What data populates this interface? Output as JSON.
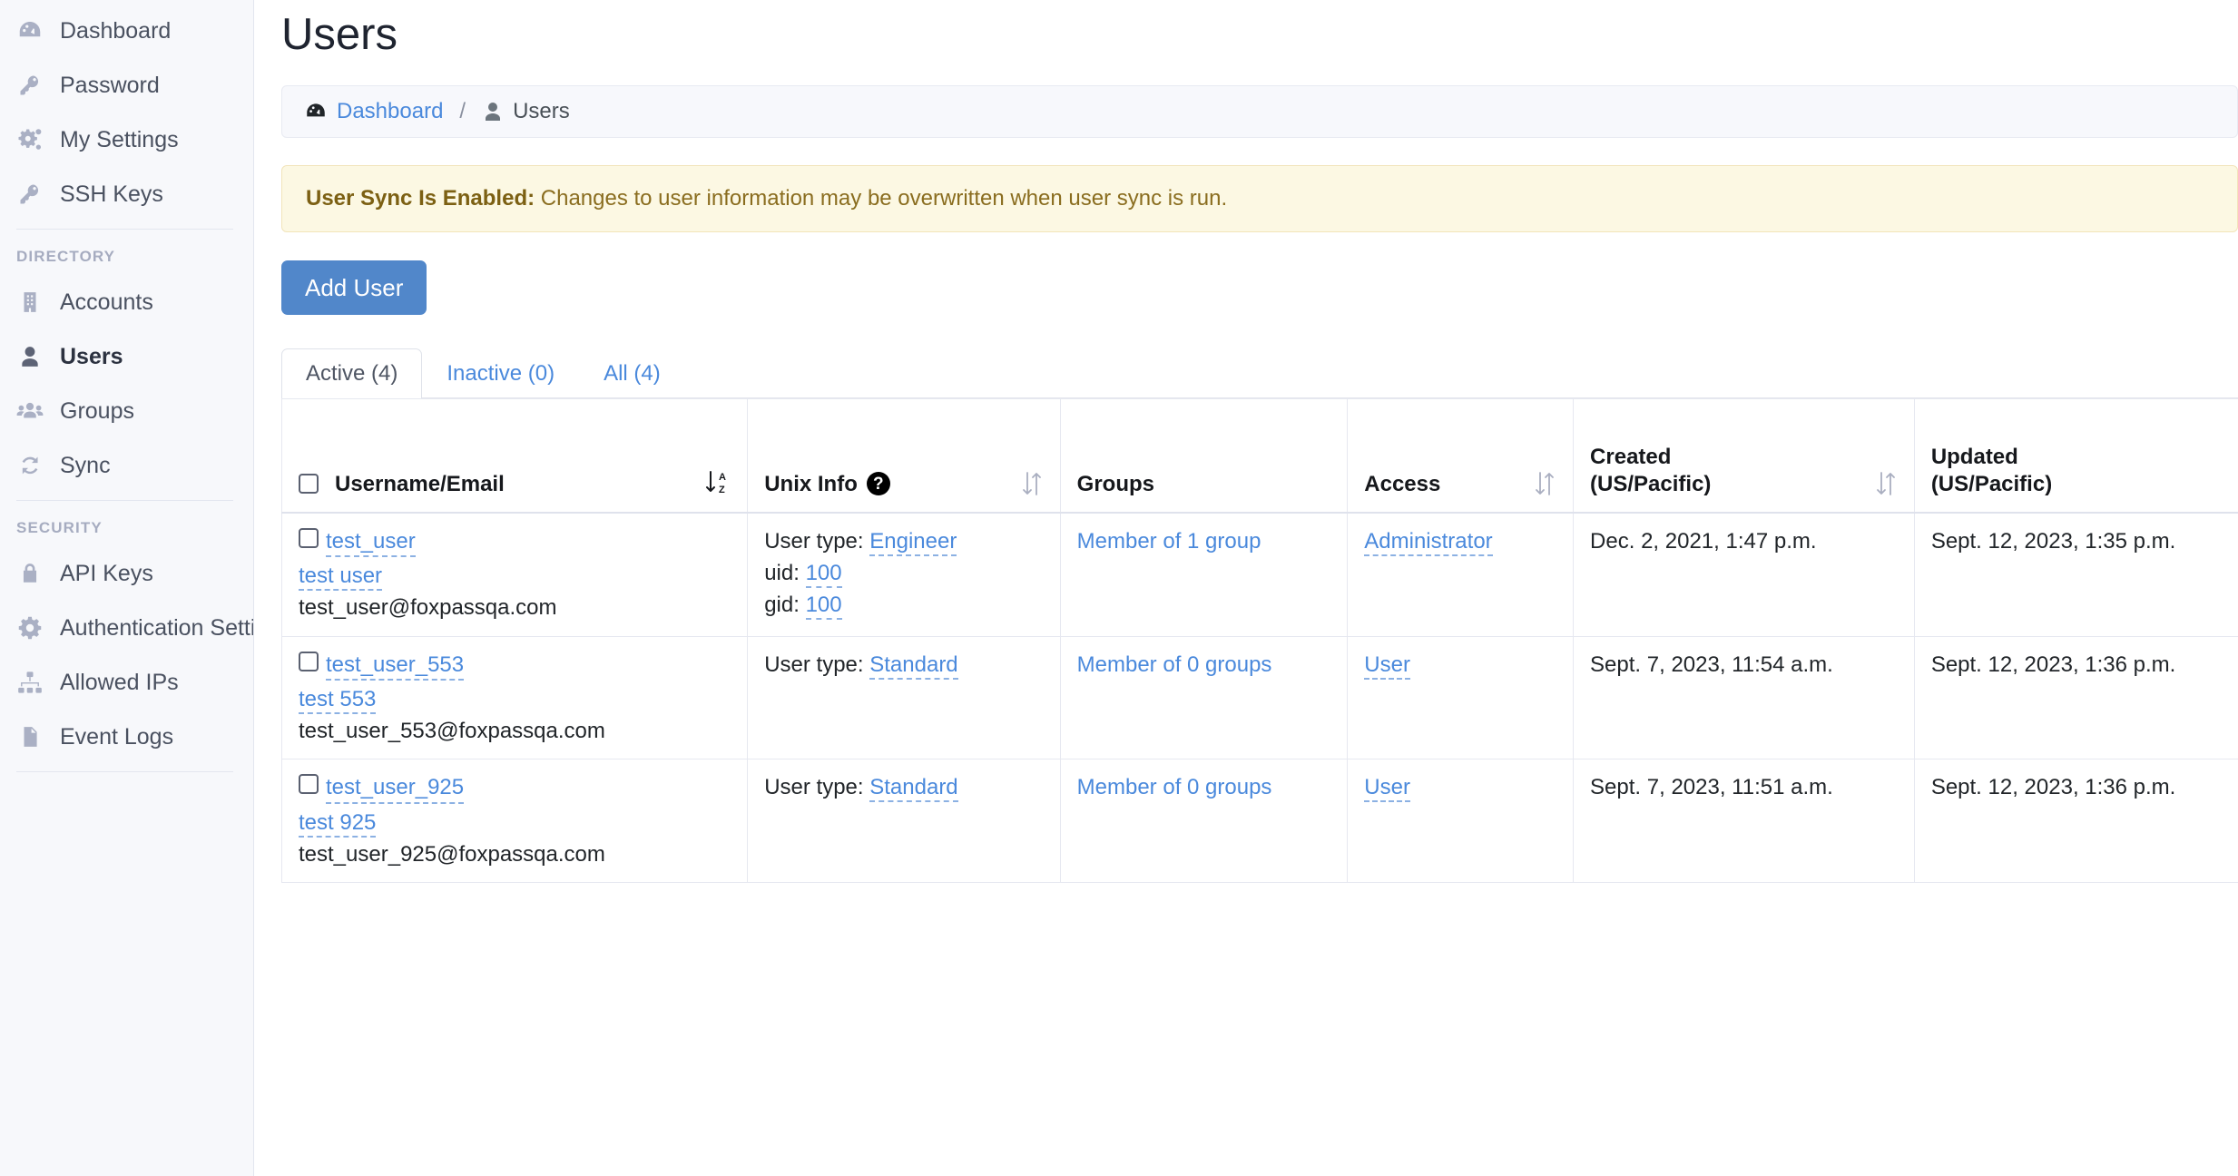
{
  "sidebar": {
    "items_top": [
      {
        "label": "Dashboard",
        "icon": "dashboard-icon",
        "active": false
      },
      {
        "label": "Password",
        "icon": "key-icon",
        "active": false
      },
      {
        "label": "My Settings",
        "icon": "gears-icon",
        "active": false
      },
      {
        "label": "SSH Keys",
        "icon": "key-icon",
        "active": false
      }
    ],
    "group_directory_title": "DIRECTORY",
    "items_directory": [
      {
        "label": "Accounts",
        "icon": "building-icon",
        "active": false
      },
      {
        "label": "Users",
        "icon": "user-icon",
        "active": true
      },
      {
        "label": "Groups",
        "icon": "users-group-icon",
        "active": false
      },
      {
        "label": "Sync",
        "icon": "sync-icon",
        "active": false
      }
    ],
    "group_security_title": "SECURITY",
    "items_security": [
      {
        "label": "API Keys",
        "icon": "lock-icon",
        "active": false
      },
      {
        "label": "Authentication Settings",
        "icon": "gear-icon",
        "active": false
      },
      {
        "label": "Allowed IPs",
        "icon": "sitemap-icon",
        "active": false
      },
      {
        "label": "Event Logs",
        "icon": "file-lines-icon",
        "active": false
      }
    ]
  },
  "header": {
    "title": "Users"
  },
  "breadcrumb": {
    "dashboard_label": "Dashboard",
    "separator": "/",
    "current_label": "Users"
  },
  "alert": {
    "strong": "User Sync Is Enabled:",
    "text": " Changes to user information may be overwritten when user sync is run."
  },
  "toolbar": {
    "add_user_label": "Add User"
  },
  "tabs": [
    {
      "label": "Active (4)",
      "active": true
    },
    {
      "label": "Inactive (0)",
      "active": false
    },
    {
      "label": "All (4)",
      "active": false
    }
  ],
  "table": {
    "columns": [
      {
        "label": "Username/Email",
        "sort": "alpha-down",
        "has_checkbox": true
      },
      {
        "label": "Unix Info",
        "sort": "updown",
        "help": "?"
      },
      {
        "label": "Groups",
        "sort": "none"
      },
      {
        "label": "Access",
        "sort": "updown"
      },
      {
        "label": "Created\n(US/Pacific)",
        "label_line1": "Created",
        "label_line2": "(US/Pacific)",
        "sort": "updown"
      },
      {
        "label": "Updated\n(US/Pacific)",
        "label_line1": "Updated",
        "label_line2": "(US/Pacific)",
        "sort": "updown"
      }
    ],
    "rows": [
      {
        "username": "test_user",
        "fullname": "test user",
        "email": "test_user@foxpassqa.com",
        "unix_type_label": "User type:",
        "unix_type_value": "Engineer",
        "uid_label": "uid:",
        "uid_value": "100",
        "gid_label": "gid:",
        "gid_value": "100",
        "groups": "Member of 1 group",
        "access": "Administrator",
        "created": "Dec. 2, 2021, 1:47 p.m.",
        "updated": "Sept. 12, 2023, 1:35 p.m."
      },
      {
        "username": "test_user_553",
        "fullname": "test 553",
        "email": "test_user_553@foxpassqa.com",
        "unix_type_label": "User type:",
        "unix_type_value": "Standard",
        "uid_label": "",
        "uid_value": "",
        "gid_label": "",
        "gid_value": "",
        "groups": "Member of 0 groups",
        "access": "User",
        "created": "Sept. 7, 2023, 11:54 a.m.",
        "updated": "Sept. 12, 2023, 1:36 p.m."
      },
      {
        "username": "test_user_925",
        "fullname": "test 925",
        "email": "test_user_925@foxpassqa.com",
        "unix_type_label": "User type:",
        "unix_type_value": "Standard",
        "uid_label": "",
        "uid_value": "",
        "gid_label": "",
        "gid_value": "",
        "groups": "Member of 0 groups",
        "access": "User",
        "created": "Sept. 7, 2023, 11:51 a.m.",
        "updated": "Sept. 12, 2023, 1:36 p.m."
      }
    ]
  },
  "colors": {
    "link": "#4a89dc",
    "primary_button": "#5187ca",
    "alert_bg": "#fcf8e3",
    "alert_text": "#8a6d1f",
    "sidebar_bg": "#f7f8fb"
  }
}
